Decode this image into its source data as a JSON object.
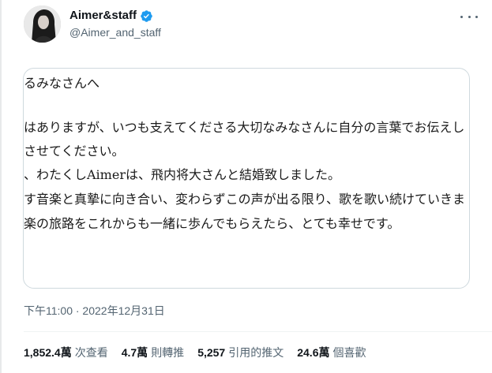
{
  "header": {
    "display_name": "Aimer&staff",
    "handle": "@Aimer_and_staff",
    "verified": true
  },
  "letter": {
    "lines": [
      "るみなさんへ",
      "はありますが、いつも支えてくださる大切なみなさんに自分の言葉でお伝えし",
      "させてください。",
      "、わたくしAimerは、飛内将大さんと結婚致しました。",
      "す音楽と真摯に向き合い、変わらずこの声が出る限り、歌を歌い続けていきま",
      "楽の旅路をこれからも一緒に歩んでもらえたら、とても幸せです。"
    ]
  },
  "timestamp": "下午11:00 · 2022年12月31日",
  "stats": [
    {
      "value": "1,852.4萬",
      "label": "次查看"
    },
    {
      "value": "4.7萬",
      "label": "則轉推"
    },
    {
      "value": "5,257",
      "label": "引用的推文"
    },
    {
      "value": "24.6萬",
      "label": "個喜歡"
    }
  ],
  "colors": {
    "verified_badge": "#1d9bf0",
    "secondary_text": "#536471",
    "primary_text": "#0f1419",
    "border": "#cfd9de"
  }
}
